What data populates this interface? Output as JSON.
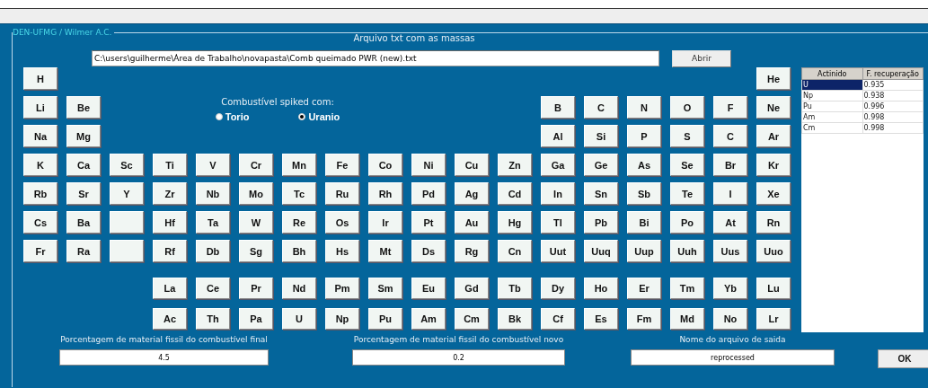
{
  "panel_title": "DEN-UFMG / Wilmer A.C.",
  "file": {
    "label": "Arquivo txt com as massas",
    "value": "C:\\users\\guilherme\\Área de Trabalho\\novapasta\\Comb queimado PWR (new).txt",
    "button": "Abrir"
  },
  "spike": {
    "label": "Combustível spiked com:",
    "options": [
      {
        "label": "Torio",
        "selected": false
      },
      {
        "label": "Uranio",
        "selected": true
      }
    ]
  },
  "periodic_table": {
    "rows": [
      [
        {
          "kind": "element",
          "symbol": "H"
        },
        null,
        null,
        null,
        null,
        null,
        null,
        null,
        null,
        null,
        null,
        null,
        null,
        null,
        null,
        null,
        null,
        {
          "kind": "element",
          "symbol": "He"
        }
      ],
      [
        {
          "kind": "element",
          "symbol": "Li"
        },
        {
          "kind": "element",
          "symbol": "Be"
        },
        null,
        null,
        null,
        null,
        null,
        null,
        null,
        null,
        null,
        null,
        {
          "kind": "element",
          "symbol": "B"
        },
        {
          "kind": "element",
          "symbol": "C"
        },
        {
          "kind": "element",
          "symbol": "N"
        },
        {
          "kind": "element",
          "symbol": "O"
        },
        {
          "kind": "element",
          "symbol": "F"
        },
        {
          "kind": "element",
          "symbol": "Ne"
        }
      ],
      [
        {
          "kind": "element",
          "symbol": "Na"
        },
        {
          "kind": "element",
          "symbol": "Mg"
        },
        null,
        null,
        null,
        null,
        null,
        null,
        null,
        null,
        null,
        null,
        {
          "kind": "element",
          "symbol": "Al"
        },
        {
          "kind": "element",
          "symbol": "Si"
        },
        {
          "kind": "element",
          "symbol": "P"
        },
        {
          "kind": "element",
          "symbol": "S"
        },
        {
          "kind": "element",
          "symbol": "C"
        },
        {
          "kind": "element",
          "symbol": "Ar"
        }
      ],
      [
        {
          "kind": "element",
          "symbol": "K"
        },
        {
          "kind": "element",
          "symbol": "Ca"
        },
        {
          "kind": "element",
          "symbol": "Sc"
        },
        {
          "kind": "element",
          "symbol": "Ti"
        },
        {
          "kind": "element",
          "symbol": "V"
        },
        {
          "kind": "element",
          "symbol": "Cr"
        },
        {
          "kind": "element",
          "symbol": "Mn"
        },
        {
          "kind": "element",
          "symbol": "Fe"
        },
        {
          "kind": "element",
          "symbol": "Co"
        },
        {
          "kind": "element",
          "symbol": "Ni"
        },
        {
          "kind": "element",
          "symbol": "Cu"
        },
        {
          "kind": "element",
          "symbol": "Zn"
        },
        {
          "kind": "element",
          "symbol": "Ga"
        },
        {
          "kind": "element",
          "symbol": "Ge"
        },
        {
          "kind": "element",
          "symbol": "As"
        },
        {
          "kind": "element",
          "symbol": "Se"
        },
        {
          "kind": "element",
          "symbol": "Br"
        },
        {
          "kind": "element",
          "symbol": "Kr"
        }
      ],
      [
        {
          "kind": "element",
          "symbol": "Rb"
        },
        {
          "kind": "element",
          "symbol": "Sr"
        },
        {
          "kind": "element",
          "symbol": "Y"
        },
        {
          "kind": "element",
          "symbol": "Zr"
        },
        {
          "kind": "element",
          "symbol": "Nb"
        },
        {
          "kind": "element",
          "symbol": "Mo"
        },
        {
          "kind": "element",
          "symbol": "Tc"
        },
        {
          "kind": "element",
          "symbol": "Ru"
        },
        {
          "kind": "element",
          "symbol": "Rh"
        },
        {
          "kind": "element",
          "symbol": "Pd"
        },
        {
          "kind": "element",
          "symbol": "Ag"
        },
        {
          "kind": "element",
          "symbol": "Cd"
        },
        {
          "kind": "element",
          "symbol": "In"
        },
        {
          "kind": "element",
          "symbol": "Sn"
        },
        {
          "kind": "element",
          "symbol": "Sb"
        },
        {
          "kind": "element",
          "symbol": "Te"
        },
        {
          "kind": "element",
          "symbol": "I"
        },
        {
          "kind": "element",
          "symbol": "Xe"
        }
      ],
      [
        {
          "kind": "element",
          "symbol": "Cs"
        },
        {
          "kind": "element",
          "symbol": "Ba"
        },
        {
          "kind": "blank"
        },
        {
          "kind": "element",
          "symbol": "Hf"
        },
        {
          "kind": "element",
          "symbol": "Ta"
        },
        {
          "kind": "element",
          "symbol": "W"
        },
        {
          "kind": "element",
          "symbol": "Re"
        },
        {
          "kind": "element",
          "symbol": "Os"
        },
        {
          "kind": "element",
          "symbol": "Ir"
        },
        {
          "kind": "element",
          "symbol": "Pt"
        },
        {
          "kind": "element",
          "symbol": "Au"
        },
        {
          "kind": "element",
          "symbol": "Hg"
        },
        {
          "kind": "element",
          "symbol": "Tl"
        },
        {
          "kind": "element",
          "symbol": "Pb"
        },
        {
          "kind": "element",
          "symbol": "Bi"
        },
        {
          "kind": "element",
          "symbol": "Po"
        },
        {
          "kind": "element",
          "symbol": "At"
        },
        {
          "kind": "element",
          "symbol": "Rn"
        }
      ],
      [
        {
          "kind": "element",
          "symbol": "Fr"
        },
        {
          "kind": "element",
          "symbol": "Ra"
        },
        {
          "kind": "blank"
        },
        {
          "kind": "element",
          "symbol": "Rf"
        },
        {
          "kind": "element",
          "symbol": "Db"
        },
        {
          "kind": "element",
          "symbol": "Sg"
        },
        {
          "kind": "element",
          "symbol": "Bh"
        },
        {
          "kind": "element",
          "symbol": "Hs"
        },
        {
          "kind": "element",
          "symbol": "Mt"
        },
        {
          "kind": "element",
          "symbol": "Ds"
        },
        {
          "kind": "element",
          "symbol": "Rg"
        },
        {
          "kind": "element",
          "symbol": "Cn"
        },
        {
          "kind": "element",
          "symbol": "Uut"
        },
        {
          "kind": "element",
          "symbol": "Uuq"
        },
        {
          "kind": "element",
          "symbol": "Uup"
        },
        {
          "kind": "element",
          "symbol": "Uuh"
        },
        {
          "kind": "element",
          "symbol": "Uus"
        },
        {
          "kind": "element",
          "symbol": "Uuo"
        }
      ]
    ],
    "f_block": [
      [
        "La",
        "Ce",
        "Pr",
        "Nd",
        "Pm",
        "Sm",
        "Eu",
        "Gd",
        "Tb",
        "Dy",
        "Ho",
        "Er",
        "Tm",
        "Yb",
        "Lu"
      ],
      [
        "Ac",
        "Th",
        "Pa",
        "U",
        "Np",
        "Pu",
        "Am",
        "Cm",
        "Bk",
        "Cf",
        "Es",
        "Fm",
        "Md",
        "No",
        "Lr"
      ]
    ]
  },
  "recovery_table": {
    "columns": [
      "Actinido",
      "F. recuperação"
    ],
    "rows": [
      {
        "cells": [
          "U",
          "0.935"
        ],
        "selected": true
      },
      {
        "cells": [
          "Np",
          "0.938"
        ],
        "selected": false
      },
      {
        "cells": [
          "Pu",
          "0.996"
        ],
        "selected": false
      },
      {
        "cells": [
          "Am",
          "0.998"
        ],
        "selected": false
      },
      {
        "cells": [
          "Cm",
          "0.998"
        ],
        "selected": false
      }
    ]
  },
  "outputs": [
    {
      "label": "Porcentagem de material fissil do combustível final",
      "value": "4.5"
    },
    {
      "label": "Porcentagem de material fissil do combustível novo",
      "value": "0.2"
    },
    {
      "label": "Nome do arquivo de saida",
      "value": "reprocessed"
    }
  ],
  "ok_button": "OK"
}
